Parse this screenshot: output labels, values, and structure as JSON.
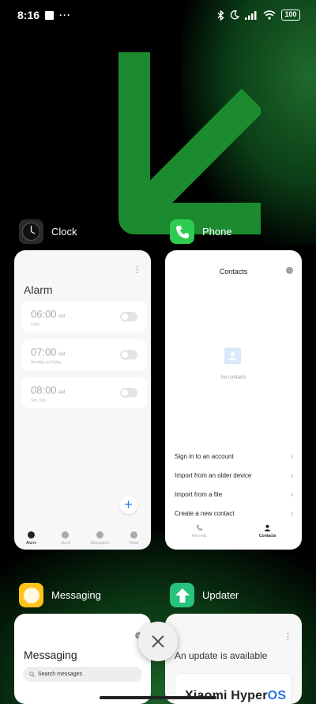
{
  "status_bar": {
    "time": "8:16",
    "dots": "···",
    "battery": "100",
    "icons": [
      "notification-square-icon",
      "bluetooth-icon",
      "moon-icon",
      "signal-icon",
      "wifi-icon",
      "battery-icon"
    ]
  },
  "recents": [
    {
      "app": "Clock",
      "icon": "clock-app-icon",
      "screen": {
        "more": "⋮",
        "title": "Alarm",
        "alarms": [
          {
            "time": "06:00",
            "ampm": "AM",
            "sub": "Daily",
            "enabled": false
          },
          {
            "time": "07:00",
            "ampm": "AM",
            "sub": "Monday to Friday",
            "enabled": false
          },
          {
            "time": "08:00",
            "ampm": "AM",
            "sub": "Sat, Sun",
            "enabled": false
          }
        ],
        "fab": "+",
        "tabs": [
          "Alarm",
          "Clock",
          "Stopwatch",
          "Timer"
        ],
        "active_tab": "Alarm"
      }
    },
    {
      "app": "Phone",
      "icon": "phone-app-icon",
      "screen": {
        "title": "Contacts",
        "empty_text": "No contacts",
        "actions": [
          "Sign in to an account",
          "Import from an older device",
          "Import from a file",
          "Create a new contact"
        ],
        "tabs": [
          "Recents",
          "Contacts"
        ],
        "active_tab": "Contacts"
      }
    },
    {
      "app": "Messaging",
      "icon": "messaging-app-icon",
      "screen": {
        "title": "Messaging",
        "search_placeholder": "Search messages"
      }
    },
    {
      "app": "Updater",
      "icon": "updater-app-icon",
      "screen": {
        "more": "⋮",
        "title": "An update is available",
        "brand": "Xiaomi Hyper",
        "brand_os": "OS"
      }
    }
  ],
  "close_button_label": "×",
  "colors": {
    "accent_blue": "#2c7ef0",
    "phone_green": "#2ecc4f",
    "updater_green": "#27c27d",
    "wallpaper_green": "#1c8a2e"
  }
}
